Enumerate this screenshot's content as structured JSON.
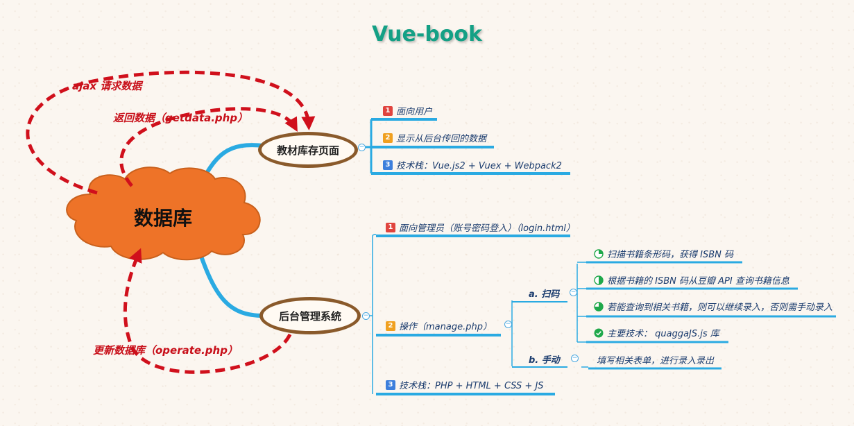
{
  "title": "Vue-book",
  "center": {
    "label": "数据库"
  },
  "branches": {
    "frontend": {
      "label": "教材库存页面",
      "items": [
        {
          "badge": "1",
          "text": "面向用户"
        },
        {
          "badge": "2",
          "text": "显示从后台传回的数据"
        },
        {
          "badge": "3",
          "text": "技术栈：Vue.js2 + Vuex + Webpack2"
        }
      ]
    },
    "backend": {
      "label": "后台管理系统",
      "items": [
        {
          "badge": "1",
          "text": "面向管理员（账号密码登入）（login.html）"
        },
        {
          "badge": "2",
          "text": "操作（manage.php）"
        },
        {
          "badge": "3",
          "text": "技术栈：PHP + HTML + CSS + JS"
        }
      ],
      "operations": {
        "scan": {
          "label": "a. 扫码",
          "steps": [
            {
              "icon": "progress-quarter-icon",
              "text": "扫描书籍条形码，获得 ISBN 码"
            },
            {
              "icon": "progress-half-icon",
              "text": "根据书籍的 ISBN 码从豆瓣 API 查询书籍信息"
            },
            {
              "icon": "progress-three-quarter-icon",
              "text": "若能查询到相关书籍，则可以继续录入，否则需手动录入"
            },
            {
              "icon": "check-circle-icon",
              "text": "主要技术： quaggaJS.js 库"
            }
          ]
        },
        "manual": {
          "label": "b. 手动",
          "steps": [
            {
              "text": "填写相关表单，进行录入录出"
            }
          ]
        }
      }
    }
  },
  "arrows": {
    "ajax": "ajax 请求数据",
    "return": "返回数据（getdata.php）",
    "update": "更新数据库（operate.php）"
  },
  "colors": {
    "branch": "#2aaae2",
    "arrow": "#d0101c",
    "cloud": "#ee7328",
    "title": "#14a085",
    "oval_border": "#8a5a2b"
  }
}
